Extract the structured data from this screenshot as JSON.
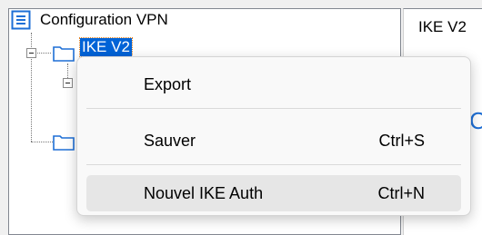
{
  "tree": {
    "root_label": "Configuration VPN",
    "selected_label": "IKE V2"
  },
  "right_panel": {
    "title": "IKE V2",
    "partial_glyph": "C"
  },
  "context_menu": {
    "items": [
      {
        "label": "Export",
        "shortcut": ""
      },
      {
        "label": "Sauver",
        "shortcut": "Ctrl+S"
      },
      {
        "label": "Nouvel IKE Auth",
        "shortcut": "Ctrl+N"
      }
    ]
  },
  "colors": {
    "selection": "#0063d7",
    "icon_blue": "#1e6fd6",
    "menu_hover": "#e6e6e6"
  }
}
